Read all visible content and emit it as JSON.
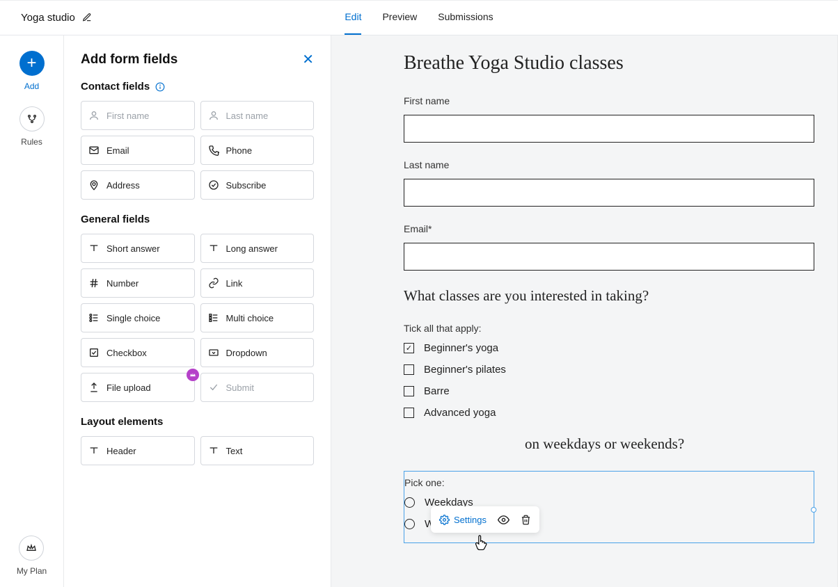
{
  "header": {
    "form_name": "Yoga studio",
    "tabs": {
      "edit": "Edit",
      "preview": "Preview",
      "submissions": "Submissions"
    }
  },
  "rail": {
    "add": "Add",
    "rules": "Rules",
    "plan": "My Plan"
  },
  "panel": {
    "title": "Add form fields",
    "sections": {
      "contact": "Contact fields",
      "general": "General fields",
      "layout": "Layout elements"
    },
    "fields": {
      "first_name": "First name",
      "last_name": "Last name",
      "email": "Email",
      "phone": "Phone",
      "address": "Address",
      "subscribe": "Subscribe",
      "short_answer": "Short answer",
      "long_answer": "Long answer",
      "number": "Number",
      "link": "Link",
      "single_choice": "Single choice",
      "multi_choice": "Multi choice",
      "checkbox": "Checkbox",
      "dropdown": "Dropdown",
      "file_upload": "File upload",
      "submit": "Submit",
      "header": "Header",
      "text": "Text"
    }
  },
  "form": {
    "title": "Breathe Yoga Studio classes",
    "labels": {
      "first_name": "First name",
      "last_name": "Last name",
      "email": "Email*"
    },
    "question_classes": "What classes are you interested in taking?",
    "tick_all": "Tick all that apply:",
    "classes": {
      "c1": "Beginner's yoga",
      "c2": "Beginner's pilates",
      "c3": "Barre",
      "c4": "Advanced yoga"
    },
    "question_days": "on weekdays or weekends?",
    "pick_one": "Pick one:",
    "days": {
      "d1": "Weekdays",
      "d2": "Weekends"
    }
  },
  "toolbar": {
    "settings": "Settings"
  }
}
